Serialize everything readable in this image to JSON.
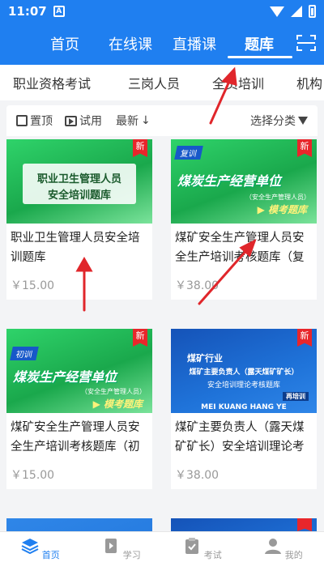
{
  "status": {
    "time": "11:07",
    "notif": "A"
  },
  "top_tabs": [
    "首页",
    "在线课",
    "直播课",
    "题库"
  ],
  "categories": [
    "职业资格考试",
    "三岗人员",
    "全员培训",
    "机构"
  ],
  "filters": {
    "top": "置顶",
    "trial": "试用",
    "new": "最新",
    "new_arrow": "↓",
    "category": "选择分类"
  },
  "cards": [
    {
      "title": "职业卫生管理人员安全培训题库",
      "price": "￥15.00",
      "badge": "新",
      "thumb": {
        "line1": "职业卫生管理人员",
        "line2": "安全培训题库"
      }
    },
    {
      "title": "煤矿安全生产管理人员安全生产培训考核题库（复",
      "price": "￥38.00",
      "badge": "新",
      "thumb": {
        "tag": "复训",
        "big": "煤炭生产经营单位",
        "small": "（安全生产管理人员）",
        "cta": "▶ 模考题库"
      }
    },
    {
      "title": "煤矿安全生产管理人员安全生产培训考核题库（初训）",
      "price": "￥15.00",
      "badge": "新",
      "thumb": {
        "tag": "初训",
        "big": "煤炭生产经营单位",
        "small": "（安全生产管理人员）",
        "cta": "▶ 模考题库"
      }
    },
    {
      "title": "煤矿主要负责人（露天煤矿矿长）安全培训理论考",
      "price": "￥38.00",
      "badge": "新",
      "thumb": {
        "line1": "煤矿行业",
        "line2": "煤矿主要负责人（露天煤矿矿长）",
        "line3": "安全培训理论考核题库",
        "tag": "再培训",
        "footer": "MEI KUANG HANG YE"
      }
    }
  ],
  "bottom_nav": [
    "首页",
    "学习",
    "考试",
    "我的"
  ],
  "colors": {
    "brand": "#1f7ff0",
    "badge_red": "#e8262b",
    "annotation_red": "#e0262b"
  }
}
